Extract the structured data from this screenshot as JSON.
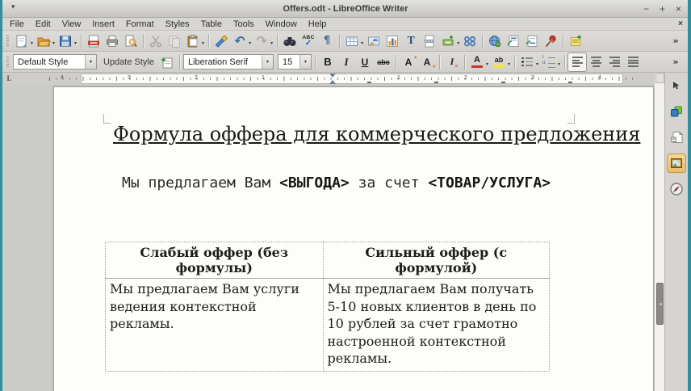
{
  "window": {
    "title": "Offers.odt - LibreOffice Writer",
    "menu_icon": "▾",
    "minimize": "−",
    "maximize": "+",
    "close": "×"
  },
  "menubar": {
    "items": [
      "File",
      "Edit",
      "View",
      "Insert",
      "Format",
      "Styles",
      "Table",
      "Tools",
      "Window",
      "Help"
    ],
    "close_document": "×"
  },
  "ui": {
    "dropdown_arrow": "▾",
    "up_arrow": "▴",
    "down_arrow": "▾",
    "tab_selector": "L"
  },
  "standard_toolbar": {
    "icons": [
      "new-document",
      "open",
      "save",
      "export-pdf",
      "print",
      "print-preview",
      "cut",
      "copy",
      "paste",
      "clone-formatting",
      "undo",
      "redo",
      "find-and-replace",
      "spelling",
      "formatting-marks",
      "insert-table",
      "insert-image",
      "insert-chart",
      "insert-text-box",
      "insert-page-break",
      "insert-field",
      "insert-special-character",
      "insert-hyperlink",
      "insert-footnote",
      "insert-endnote",
      "insert-bookmark",
      "insert-comment"
    ],
    "glyphs": {
      "undo": "↶",
      "redo": "↷",
      "pilcrow": "¶",
      "textbox": "T",
      "spelling_abc": "ABC",
      "spelling_check": "✓",
      "overflow": "»"
    }
  },
  "formatting_toolbar": {
    "paragraph_style": "Default Style",
    "update_style": "Update Style",
    "font_name": "Liberation Serif",
    "font_size": "15",
    "bold": "B",
    "italic": "I",
    "underline": "U",
    "strikethrough": "abc",
    "increase_size": "A",
    "decrease_size": "A",
    "clear_formatting": "I",
    "clear_x": "×",
    "font_color": "A",
    "highlight": "ab",
    "overflow": "»"
  },
  "ruler": {
    "labels": [
      "4",
      "3",
      "2",
      "1",
      "1",
      "2",
      "3",
      "4"
    ]
  },
  "sidebar": {
    "icons": [
      "sidebar-settings",
      "properties",
      "page",
      "gallery",
      "navigator"
    ],
    "active": "gallery"
  },
  "document": {
    "heading": "Формула оффера для коммерческого предложения",
    "offer": {
      "p1": "Мы предлагаем Вам ",
      "b1": "<ВЫГОДА>",
      "p2": " за счет ",
      "b2": "<ТОВАР/УСЛУГА>"
    },
    "table": {
      "headers": [
        "Слабый оффер (без формулы)",
        "Сильный оффер (с формулой)"
      ],
      "rows": [
        [
          "Мы предлагаем Вам услуги ведения контекстной рекламы.",
          "Мы предлагаем Вам получать 5-10 новых клиентов в день по 10 рублей за счет грамотно настроенной контекстной рекламы."
        ]
      ]
    }
  },
  "colors": {
    "accent_teal": "#2f8f9b",
    "highlight_yellow": "#f7e245",
    "font_color_red": "#c5351f"
  }
}
